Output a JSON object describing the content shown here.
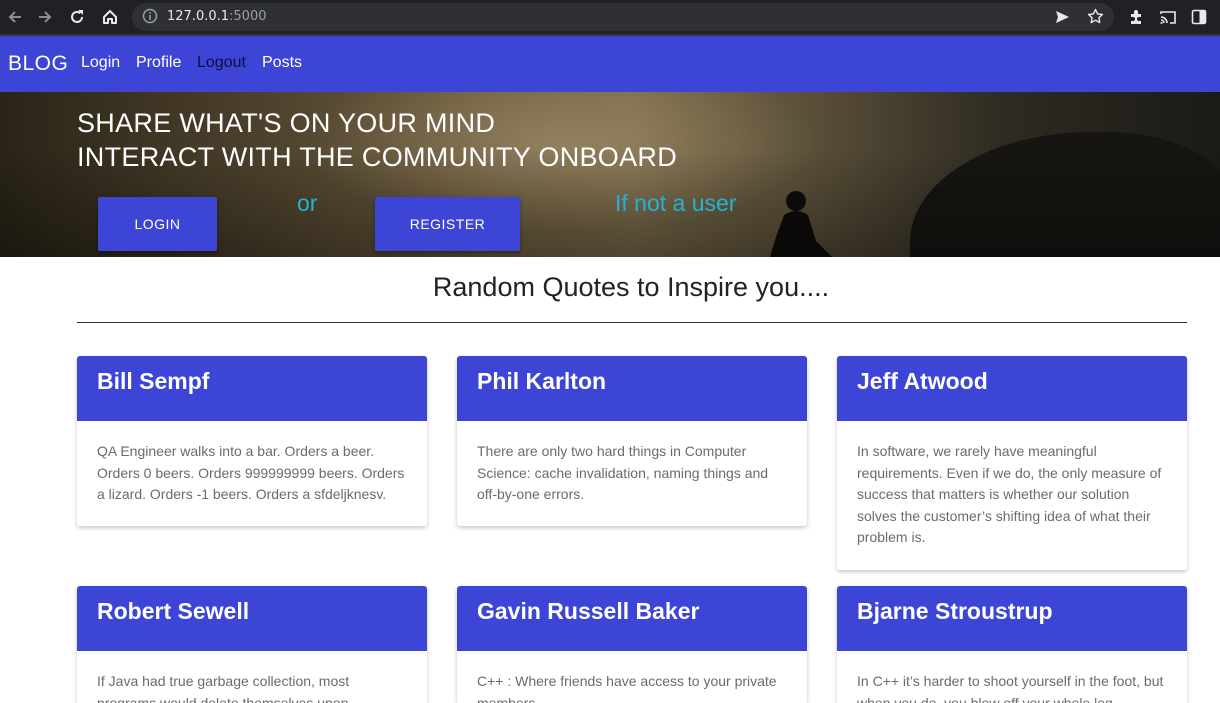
{
  "browser": {
    "url_host": "127.0.0.1",
    "url_port": ":5000",
    "icons": [
      "back-icon",
      "forward-icon",
      "reload-icon",
      "home-icon",
      "info-icon",
      "send-icon",
      "star-icon",
      "extensions-icon",
      "cast-icon",
      "sidebar-icon"
    ]
  },
  "navbar": {
    "brand": "BLOG",
    "links": [
      "Login",
      "Profile",
      "Logout",
      "Posts"
    ]
  },
  "hero": {
    "line1": "SHARE WHAT'S ON YOUR MIND",
    "line2": "INTERACT WITH THE COMMUNITY ONBOARD",
    "login_label": "LOGIN",
    "or_text": "or",
    "register_label": "REGISTER",
    "note_text": "If not a user"
  },
  "quotes": {
    "title": "Random Quotes to Inspire you....",
    "cards": [
      {
        "name": "Bill Sempf",
        "text": "QA Engineer walks into a bar. Orders a beer. Orders 0 beers. Orders 999999999 beers. Orders a lizard. Orders -1 beers. Orders a sfdeljknesv."
      },
      {
        "name": "Phil Karlton",
        "text": "There are only two hard things in Computer Science: cache invalidation, naming things and off-by-one errors."
      },
      {
        "name": "Jeff Atwood",
        "text": "In software, we rarely have meaningful requirements. Even if we do, the only measure of success that matters is whether our solution solves the customer’s shifting idea of what their problem is."
      },
      {
        "name": "Robert Sewell",
        "text": "If Java had true garbage collection, most programs would delete themselves upon"
      },
      {
        "name": "Gavin Russell Baker",
        "text": "C++ : Where friends have access to your private members."
      },
      {
        "name": "Bjarne Stroustrup",
        "text": "In C++ it’s harder to shoot yourself in the foot, but when you do, you blow off your whole leg."
      }
    ]
  },
  "colors": {
    "primary": "#3c45d6",
    "accent": "#22b3d4"
  }
}
